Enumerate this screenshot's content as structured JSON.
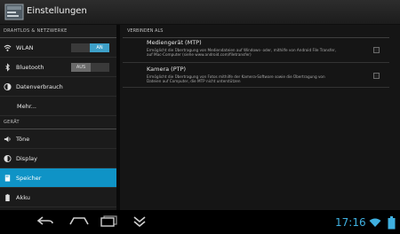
{
  "header": {
    "title": "Einstellungen"
  },
  "sidebar": {
    "section_wireless": "DRAHTLOS & NETZWERKE",
    "items_wireless": [
      {
        "label": "WLAN",
        "icon": "wifi-icon",
        "toggle": "AN"
      },
      {
        "label": "Bluetooth",
        "icon": "bluetooth-icon",
        "toggle": "AUS"
      },
      {
        "label": "Datenverbrauch",
        "icon": "data-usage-icon"
      },
      {
        "label": "Mehr..."
      }
    ],
    "section_device": "GERÄT",
    "items_device": [
      {
        "label": "Töne",
        "icon": "sound-icon"
      },
      {
        "label": "Display",
        "icon": "display-icon"
      },
      {
        "label": "Speicher",
        "icon": "storage-icon",
        "selected": true
      },
      {
        "label": "Akku",
        "icon": "battery-icon"
      }
    ]
  },
  "main": {
    "section_title": "VERBINDEN ALS",
    "options": [
      {
        "title": "Mediengerät (MTP)",
        "desc_line1": "Ermöglicht die Übertragung von Mediendateien auf Windows- oder, mithilfe von Android File Transfer,",
        "desc_line2": "auf Mac-Computer (siehe www.android.com/filetransfer)",
        "checked": false
      },
      {
        "title": "Kamera (PTP)",
        "desc_line1": "Ermöglicht die Übertragung von Fotos mithilfe der Kamera-Software sowie die Übertragung von",
        "desc_line2": "Dateien auf Computer, die MTP nicht unterstützen",
        "checked": false
      }
    ]
  },
  "statusbar": {
    "time": "17:16"
  },
  "colors": {
    "accent": "#0f93c6",
    "clock": "#3fb0e0"
  }
}
